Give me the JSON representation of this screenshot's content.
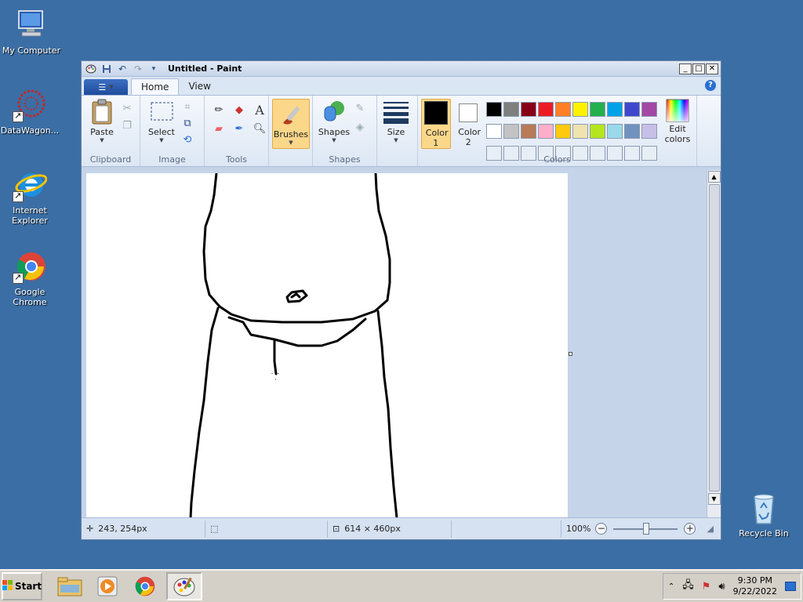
{
  "desktop": {
    "icons": [
      {
        "label": "My Computer"
      },
      {
        "label": "DataWagon..."
      },
      {
        "label": "Internet Explorer"
      },
      {
        "label": "Google Chrome"
      },
      {
        "label": "Recycle Bin"
      }
    ]
  },
  "window": {
    "title": "Untitled - Paint",
    "tabs": [
      "Home",
      "View"
    ],
    "ribbon": {
      "clipboard": {
        "paste": "Paste",
        "label": "Clipboard"
      },
      "image": {
        "select": "Select",
        "label": "Image"
      },
      "tools": {
        "label": "Tools",
        "text_glyph": "A"
      },
      "brushes": "Brushes",
      "shapes": {
        "shapes": "Shapes",
        "label": "Shapes"
      },
      "size": "Size",
      "color1": "Color 1",
      "color2": "Color 2",
      "colors": {
        "label": "Colors",
        "edit": "Edit colors"
      }
    },
    "palette": [
      "#000000",
      "#7f7f7f",
      "#880015",
      "#ed1c24",
      "#ff7f27",
      "#fff200",
      "#22b14c",
      "#00a2e8",
      "#3f48cc",
      "#a349a4",
      "#ffffff",
      "#c3c3c3",
      "#b97a57",
      "#ffaec9",
      "#ffc90e",
      "#efe4b0",
      "#b5e61d",
      "#99d9ea",
      "#7092be",
      "#c8bfe7",
      "#e8eef6",
      "#e8eef6",
      "#e8eef6",
      "#e8eef6",
      "#e8eef6",
      "#e8eef6",
      "#e8eef6",
      "#e8eef6",
      "#e8eef6",
      "#e8eef6"
    ],
    "status": {
      "cursor_pos": "243, 254px",
      "canvas_size": "614 × 460px",
      "zoom": "100%"
    }
  },
  "taskbar": {
    "start": "Start",
    "time": "9:30 PM",
    "date": "9/22/2022"
  }
}
